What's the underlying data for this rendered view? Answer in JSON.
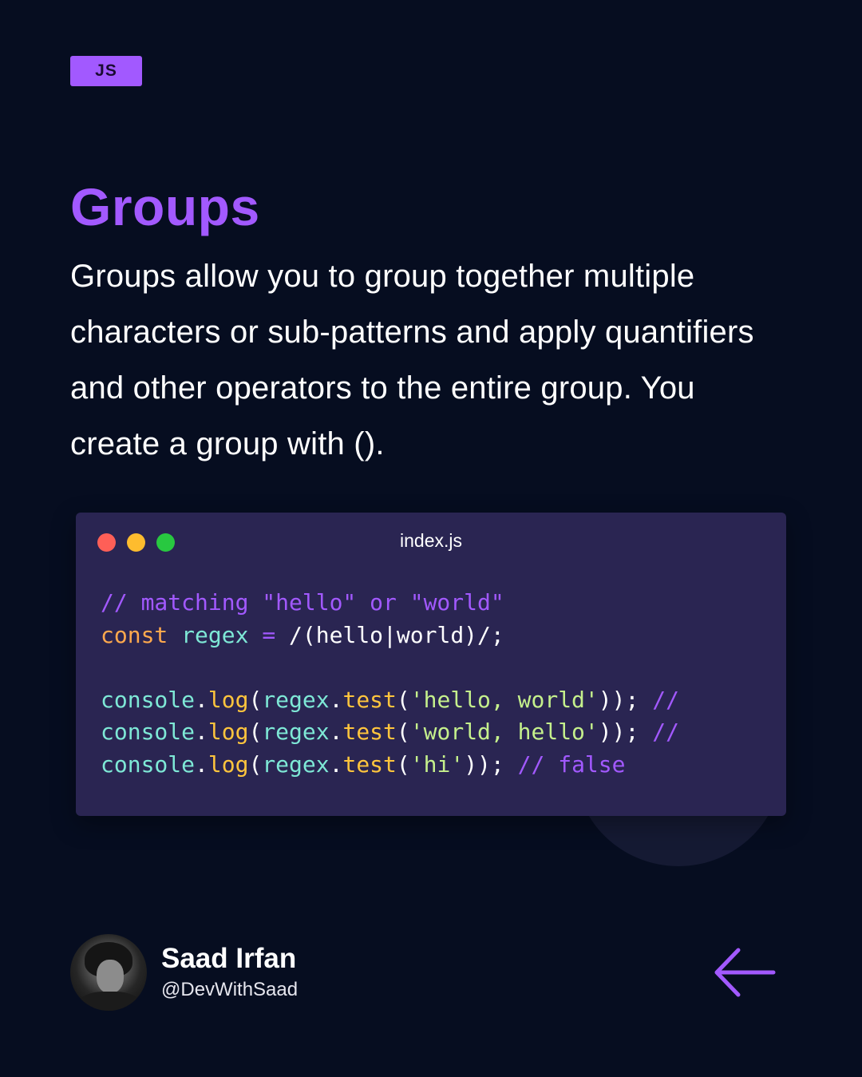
{
  "tag": {
    "label": "JS"
  },
  "title": "Groups",
  "description": "Groups allow you to group together multiple characters or sub-patterns and apply quantifiers and other operators to the entire group. You create a group with ().",
  "code_window": {
    "filename": "index.js",
    "lines": [
      [
        {
          "t": "// matching \"hello\" or \"world\"",
          "c": "comment"
        }
      ],
      [
        {
          "t": "const",
          "c": "keyword"
        },
        {
          "t": " ",
          "c": "punct"
        },
        {
          "t": "regex",
          "c": "var"
        },
        {
          "t": " ",
          "c": "punct"
        },
        {
          "t": "=",
          "c": "op"
        },
        {
          "t": " ",
          "c": "punct"
        },
        {
          "t": "/(hello|world)/",
          "c": "regex"
        },
        {
          "t": ";",
          "c": "punct"
        }
      ],
      [],
      [
        {
          "t": "console",
          "c": "var"
        },
        {
          "t": ".",
          "c": "punct"
        },
        {
          "t": "log",
          "c": "func"
        },
        {
          "t": "(",
          "c": "punct"
        },
        {
          "t": "regex",
          "c": "var"
        },
        {
          "t": ".",
          "c": "punct"
        },
        {
          "t": "test",
          "c": "func"
        },
        {
          "t": "(",
          "c": "punct"
        },
        {
          "t": "'hello, world'",
          "c": "str"
        },
        {
          "t": "));",
          "c": "punct"
        },
        {
          "t": " ",
          "c": "punct"
        },
        {
          "t": "//",
          "c": "comment"
        }
      ],
      [
        {
          "t": "console",
          "c": "var"
        },
        {
          "t": ".",
          "c": "punct"
        },
        {
          "t": "log",
          "c": "func"
        },
        {
          "t": "(",
          "c": "punct"
        },
        {
          "t": "regex",
          "c": "var"
        },
        {
          "t": ".",
          "c": "punct"
        },
        {
          "t": "test",
          "c": "func"
        },
        {
          "t": "(",
          "c": "punct"
        },
        {
          "t": "'world, hello'",
          "c": "str"
        },
        {
          "t": "));",
          "c": "punct"
        },
        {
          "t": " ",
          "c": "punct"
        },
        {
          "t": "//",
          "c": "comment"
        }
      ],
      [
        {
          "t": "console",
          "c": "var"
        },
        {
          "t": ".",
          "c": "punct"
        },
        {
          "t": "log",
          "c": "func"
        },
        {
          "t": "(",
          "c": "punct"
        },
        {
          "t": "regex",
          "c": "var"
        },
        {
          "t": ".",
          "c": "punct"
        },
        {
          "t": "test",
          "c": "func"
        },
        {
          "t": "(",
          "c": "punct"
        },
        {
          "t": "'hi'",
          "c": "str"
        },
        {
          "t": "));",
          "c": "punct"
        },
        {
          "t": " ",
          "c": "punct"
        },
        {
          "t": "// false",
          "c": "comment"
        }
      ]
    ]
  },
  "author": {
    "name": "Saad Irfan",
    "handle": "@DevWithSaad"
  },
  "icons": {
    "back": "arrow-left-icon",
    "window_controls": [
      "close-dot-icon",
      "minimize-dot-icon",
      "maximize-dot-icon"
    ]
  },
  "colors": {
    "background": "#060d20",
    "accent": "#a259ff",
    "code_bg": "#2a2552",
    "keyword": "#ffa94d",
    "variable": "#7ee8d6",
    "function": "#ffc53d",
    "string": "#c5f08c"
  }
}
